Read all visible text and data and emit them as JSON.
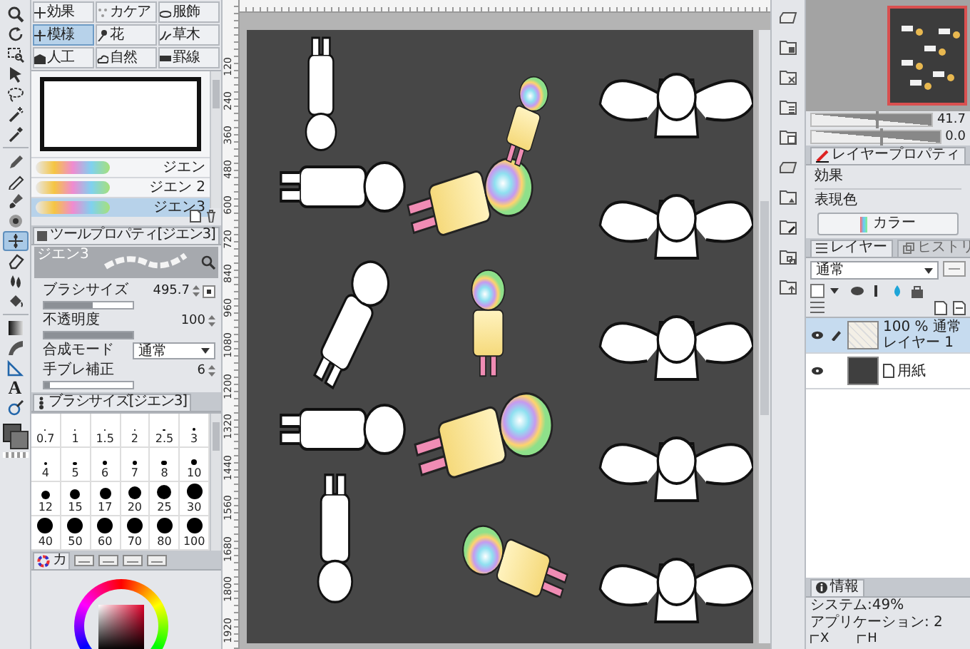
{
  "toolbar": {
    "tools": [
      {
        "selected": false
      },
      {
        "selected": false
      },
      {
        "selected": false
      },
      {
        "selected": false
      },
      {
        "selected": false
      },
      {
        "selected": false
      },
      {
        "selected": false
      },
      {
        "selected": false
      },
      {
        "selected": false
      },
      {
        "selected": false
      },
      {
        "selected": false
      },
      {
        "selected": true
      },
      {
        "selected": false
      },
      {
        "selected": false
      },
      {
        "selected": false
      },
      {
        "selected": false
      },
      {
        "selected": false
      },
      {
        "selected": false
      },
      {
        "glyph": "A",
        "selected": false
      },
      {
        "selected": false
      }
    ]
  },
  "subtool_groups": [
    {
      "label": "効果",
      "selected": false
    },
    {
      "label": "カケア",
      "selected": false
    },
    {
      "label": "服飾",
      "selected": false
    },
    {
      "label": "模様",
      "selected": true
    },
    {
      "label": "花",
      "selected": false
    },
    {
      "label": "草木",
      "selected": false
    },
    {
      "label": "人工",
      "selected": false
    },
    {
      "label": "自然",
      "selected": false
    },
    {
      "label": "罫線",
      "selected": false
    }
  ],
  "brush_list": {
    "items": [
      {
        "label": "ジエン",
        "selected": false
      },
      {
        "label": "ジエン 2",
        "selected": false
      },
      {
        "label": "ジエン3",
        "selected": true
      }
    ]
  },
  "tool_property": {
    "tab": "ツールプロパティ[ジエン3]",
    "brush_name": "ジエン3",
    "properties": [
      {
        "kind": "slider",
        "label": "ブラシサイズ",
        "value": "495.7",
        "level": 0.55
      },
      {
        "kind": "slider",
        "label": "不透明度",
        "value": "100",
        "level": 1.0
      },
      {
        "kind": "dropdown",
        "label": "合成モード",
        "value": "通常"
      },
      {
        "kind": "slider",
        "label": "手ブレ補正",
        "value": "6",
        "level": 0.06
      }
    ]
  },
  "brush_size": {
    "tab": "ブラシサイズ[ジエン3]",
    "sizes": [
      "0.7",
      "1",
      "1.5",
      "2",
      "2.5",
      "3",
      "4",
      "5",
      "6",
      "7",
      "8",
      "10",
      "12",
      "15",
      "17",
      "20",
      "25",
      "30",
      "40",
      "50",
      "60",
      "70",
      "80",
      "100"
    ]
  },
  "color_panel": {
    "tab": "カ"
  },
  "ruler": {
    "labels": [
      "120",
      "240",
      "360",
      "480",
      "600",
      "720",
      "840",
      "960",
      "1080",
      "1200",
      "1320",
      "1440",
      "1560",
      "1680",
      "1800",
      "1920"
    ]
  },
  "navigator": {
    "sliders": [
      {
        "reading": "41.7",
        "level": 0.55
      },
      {
        "reading": "0.0",
        "level": 0.55
      }
    ]
  },
  "layer_property": {
    "tab": "レイヤープロパティ",
    "effect_label": "効果",
    "color_label": "表現色",
    "color_button": "カラー"
  },
  "layer_panel": {
    "tabs": [
      {
        "label": "レイヤー",
        "selected": true
      },
      {
        "label": "ヒストリ",
        "selected": false
      }
    ],
    "blend_mode": "通常",
    "layers": [
      {
        "kind": "raster",
        "opacity_mode": "100 % 通常",
        "name": "レイヤー 1",
        "selected": true
      },
      {
        "kind": "paper",
        "name": "用紙",
        "selected": false
      }
    ]
  },
  "info": {
    "tab": "情報",
    "system": "システム:49%",
    "application": "アプリケーション: 2",
    "x_label": "X",
    "h_label": "H"
  }
}
